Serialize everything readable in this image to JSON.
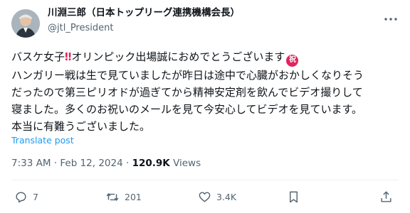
{
  "author": {
    "display_name": "川淵三郎（日本トップリーグ連携機構会長）",
    "handle": "@jtl_President",
    "avatar_icon": "avatar-photo"
  },
  "tweet": {
    "lines": [
      "バスケ女子",
      "オリンピック出場誠におめでとうございます",
      "ハンガリー戦は生で見ていましたが昨日は途中で心臓がおかしくなりそう",
      "だったので第三ピリオドが過ぎてから精神安定剤を飲んでビデオ撮りして",
      "寝ました。多くのお祝いのメールを見て今安心してビデオを見ています。",
      "本当に有難うございました。"
    ],
    "emoji_double_exclamation": "‼",
    "emoji_congrats": "祝",
    "translate_label": "Translate post"
  },
  "meta": {
    "time": "7:33 AM",
    "separator": "·",
    "date": "Feb 12, 2024",
    "views_count": "120.9K",
    "views_label": "Views"
  },
  "actions": {
    "reply_count": "7",
    "repost_count": "201",
    "like_count": "3.4K"
  },
  "colors": {
    "text": "#0f1419",
    "secondary": "#536471",
    "link": "#1d9bf0",
    "emoji_red": "#e0245e"
  }
}
